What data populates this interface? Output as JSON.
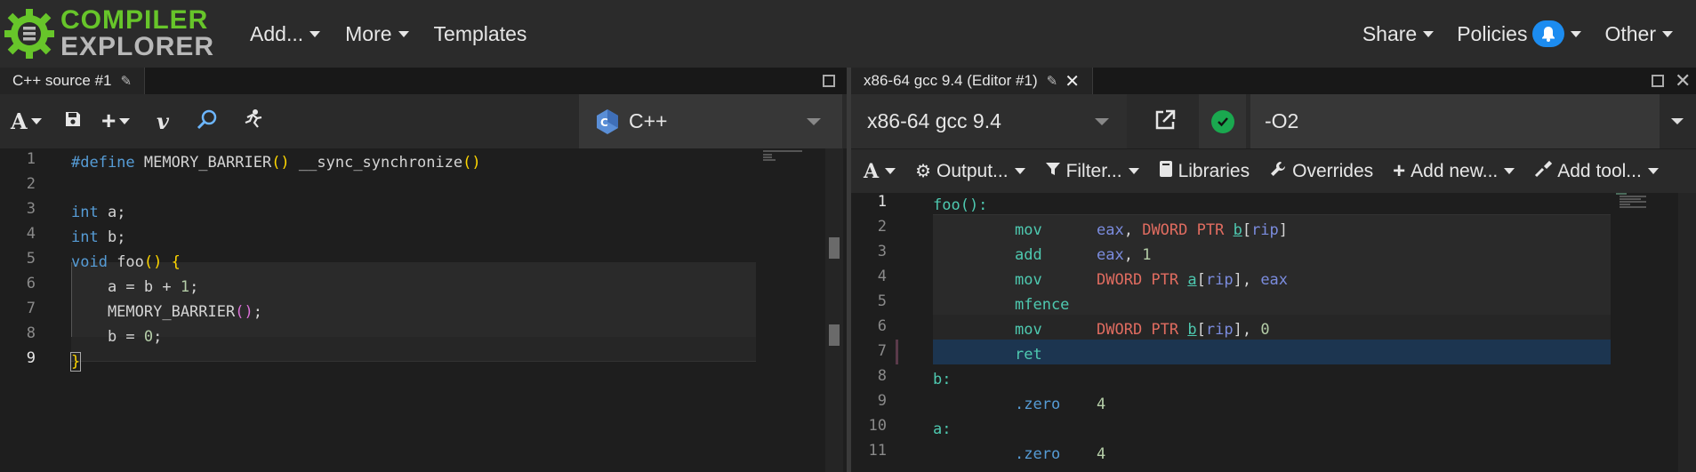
{
  "logo": {
    "line1": "COMPILER",
    "line2": "EXPLORER"
  },
  "nav": {
    "left": [
      "Add...",
      "More",
      "Templates"
    ],
    "share": "Share",
    "policies": "Policies",
    "other": "Other"
  },
  "source": {
    "tab_title": "C++ source #1",
    "language": "C++",
    "lines": [
      {
        "n": "1"
      },
      {
        "n": "2"
      },
      {
        "n": "3"
      },
      {
        "n": "4"
      },
      {
        "n": "5"
      },
      {
        "n": "6"
      },
      {
        "n": "7"
      },
      {
        "n": "8"
      },
      {
        "n": "9"
      }
    ],
    "code": {
      "l1_define": "#define",
      "l1_macro": " MEMORY_BARRIER",
      "l1_paren": "()",
      "l1_sync": " __sync_synchronize",
      "l1_paren2": "()",
      "l3_int": "int",
      "l3_rest": " a;",
      "l4_int": "int",
      "l4_rest": " b;",
      "l5_void": "void",
      "l5_foo": " foo",
      "l5_paren": "()",
      "l5_brace": " {",
      "l6_a": "    a = b + ",
      "l6_num": "1",
      "l6_semi": ";",
      "l7_macro": "    MEMORY_BARRIER",
      "l7_paren": "()",
      "l7_semi": ";",
      "l8_b": "    b = ",
      "l8_num": "0",
      "l8_semi": ";",
      "l9_brace": "}"
    }
  },
  "compiler": {
    "tab_title": "x86-64 gcc 9.4 (Editor #1)",
    "name": "x86-64 gcc 9.4",
    "options": "-O2",
    "filters": {
      "output": "Output...",
      "filter": "Filter...",
      "libraries": "Libraries",
      "overrides": "Overrides",
      "add_new": "Add new...",
      "add_tool": "Add tool..."
    },
    "asm": {
      "l1": "foo():",
      "l2_op": "mov",
      "l2_reg": "eax",
      "l2_c": ", ",
      "l2_ptr": "DWORD PTR ",
      "l2_sym": "b",
      "l2_b1": "[",
      "l2_rip": "rip",
      "l2_b2": "]",
      "l3_op": "add",
      "l3_reg": "eax",
      "l3_c": ", ",
      "l3_num": "1",
      "l4_op": "mov",
      "l4_ptr": "DWORD PTR ",
      "l4_sym": "a",
      "l4_b1": "[",
      "l4_rip": "rip",
      "l4_b2": "]",
      "l4_c": ", ",
      "l4_reg": "eax",
      "l5_op": "mfence",
      "l6_op": "mov",
      "l6_ptr": "DWORD PTR ",
      "l6_sym": "b",
      "l6_b1": "[",
      "l6_rip": "rip",
      "l6_b2": "]",
      "l6_c": ", ",
      "l6_num": "0",
      "l7_op": "ret",
      "l8": "b:",
      "l9_dir": ".zero",
      "l9_num": "4",
      "l10": "a:",
      "l11_dir": ".zero",
      "l11_num": "4"
    },
    "line_numbers": [
      "1",
      "2",
      "3",
      "4",
      "5",
      "6",
      "7",
      "8",
      "9",
      "10",
      "11"
    ]
  },
  "colors": {
    "brand_green": "#67c52a",
    "bell_blue": "#1c8cf0",
    "ok_green": "#1aa84f"
  }
}
